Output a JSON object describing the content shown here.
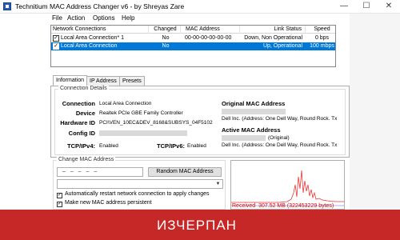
{
  "window": {
    "title": "Technitium MAC Address Changer v6 - by Shreyas Zare",
    "minimize_glyph": "—",
    "maximize_glyph": "☐",
    "close_glyph": "✕"
  },
  "menu": {
    "file": "File",
    "action": "Action",
    "options": "Options",
    "help": "Help"
  },
  "connections": {
    "headers": {
      "name": "Network Connections",
      "changed": "Changed",
      "mac": "MAC Address",
      "status": "Link Status",
      "speed": "Speed"
    },
    "rows": [
      {
        "checked": true,
        "name": "Local Area Connection* 1",
        "changed": "No",
        "mac": "00-00-00-00-00-00",
        "status": "Down, Non Operational",
        "speed": "0 bps",
        "selected": false
      },
      {
        "checked": true,
        "name": "Local Area Connection",
        "changed": "No",
        "mac": "",
        "status": "Up, Operational",
        "speed": "100 mbps",
        "selected": true
      }
    ]
  },
  "tabs": {
    "information": "Information",
    "ip_address": "IP Address",
    "presets": "Presets"
  },
  "details": {
    "legend": "Connection Details",
    "connection_label": "Connection",
    "connection_value": "Local Area Connection",
    "device_label": "Device",
    "device_value": "Realtek PCIe GBE Family Controller",
    "hardware_label": "Hardware ID",
    "hardware_value": "PCI\\VEN_10EC&DEV_8168&SUBSYS_04F5102",
    "config_label": "Config ID",
    "tcpv4_label": "TCP/IPv4:",
    "tcpv4_value": "Enabled",
    "tcpv6_label": "TCP/IPv6:",
    "tcpv6_value": "Enabled",
    "original_mac_label": "Original MAC Address",
    "original_mac_vendor": "Dell Inc.  (Address: One Dell Way, Round Rock. Tx",
    "active_mac_label": "Active MAC Address",
    "active_mac_suffix": "(Original)",
    "active_mac_vendor": "Dell Inc.  (Address: One Dell Way, Round Rock. Tx"
  },
  "change": {
    "legend": "Change MAC Address",
    "mac_placeholder": "–   –   –   –   –",
    "random_button": "Random MAC Address",
    "opt_restart": "Automatically restart network connection to apply changes",
    "opt_persistent": "Make new MAC address persistent",
    "checkmark": "✓",
    "dropdown_arrow": "▼"
  },
  "traffic": {
    "received_label": "Received",
    "received_value": "307.52 MB (322453229 bytes)"
  },
  "banner": {
    "text": "ИЗЧЕРПАН"
  },
  "colors": {
    "selection": "#0078d7",
    "banner": "#c62828",
    "graph_line": "#e53935"
  }
}
